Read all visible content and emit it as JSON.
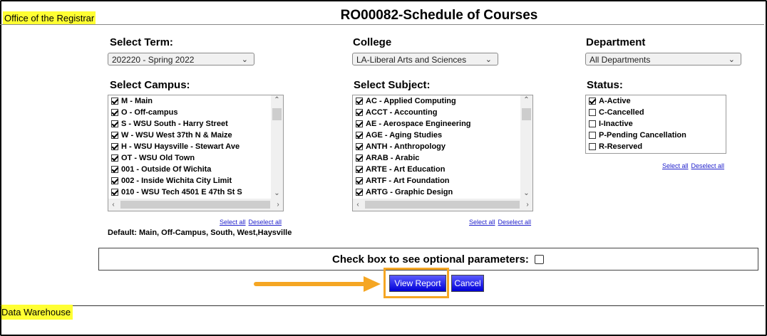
{
  "header": {
    "office": "Office of the Registrar",
    "title": "RO00082-Schedule of Courses"
  },
  "footer": {
    "label": "Data Warehouse"
  },
  "term": {
    "label": "Select Term:",
    "value": "202220 - Spring 2022"
  },
  "college": {
    "label": "College",
    "value": "LA-Liberal Arts and Sciences"
  },
  "department": {
    "label": "Department",
    "value": "All Departments"
  },
  "campus": {
    "label": "Select Campus:",
    "items": [
      {
        "text": "M - Main",
        "checked": true
      },
      {
        "text": "O - Off-campus",
        "checked": true
      },
      {
        "text": "S - WSU South - Harry Street",
        "checked": true
      },
      {
        "text": "W - WSU West 37th N & Maize",
        "checked": true
      },
      {
        "text": "H - WSU Haysville - Stewart Ave",
        "checked": true
      },
      {
        "text": "OT - WSU Old Town",
        "checked": true
      },
      {
        "text": "001 - Outside Of Wichita",
        "checked": true
      },
      {
        "text": "002 - Inside Wichita City Limit",
        "checked": true
      },
      {
        "text": "010 - WSU Tech 4501 E 47th St S",
        "checked": true
      }
    ],
    "select_all": "Select all",
    "deselect_all": "Deselect all",
    "default_note": "Default: Main, Off-Campus, South, West,Haysville"
  },
  "subject": {
    "label": "Select Subject:",
    "items": [
      {
        "text": "AC - Applied Computing",
        "checked": true
      },
      {
        "text": "ACCT - Accounting",
        "checked": true
      },
      {
        "text": "AE - Aerospace Engineering",
        "checked": true
      },
      {
        "text": "AGE - Aging Studies",
        "checked": true
      },
      {
        "text": "ANTH - Anthropology",
        "checked": true
      },
      {
        "text": "ARAB - Arabic",
        "checked": true
      },
      {
        "text": "ARTE - Art Education",
        "checked": true
      },
      {
        "text": "ARTF - Art Foundation",
        "checked": true
      },
      {
        "text": "ARTG - Graphic Design",
        "checked": true
      }
    ],
    "select_all": "Select all",
    "deselect_all": "Deselect all"
  },
  "status": {
    "label": "Status:",
    "items": [
      {
        "text": "A-Active",
        "checked": true
      },
      {
        "text": "C-Cancelled",
        "checked": false
      },
      {
        "text": "I-Inactive",
        "checked": false
      },
      {
        "text": "P-Pending Cancellation",
        "checked": false
      },
      {
        "text": "R-Reserved",
        "checked": false
      }
    ],
    "select_all": "Select all",
    "deselect_all": "Deselect all"
  },
  "optional": {
    "label": "Check box to see optional parameters:",
    "checked": false
  },
  "buttons": {
    "view_report": "View Report",
    "cancel": "Cancel"
  },
  "colors": {
    "highlight": "#ffff33",
    "callout": "#f5a623",
    "button": "#0000d6"
  }
}
